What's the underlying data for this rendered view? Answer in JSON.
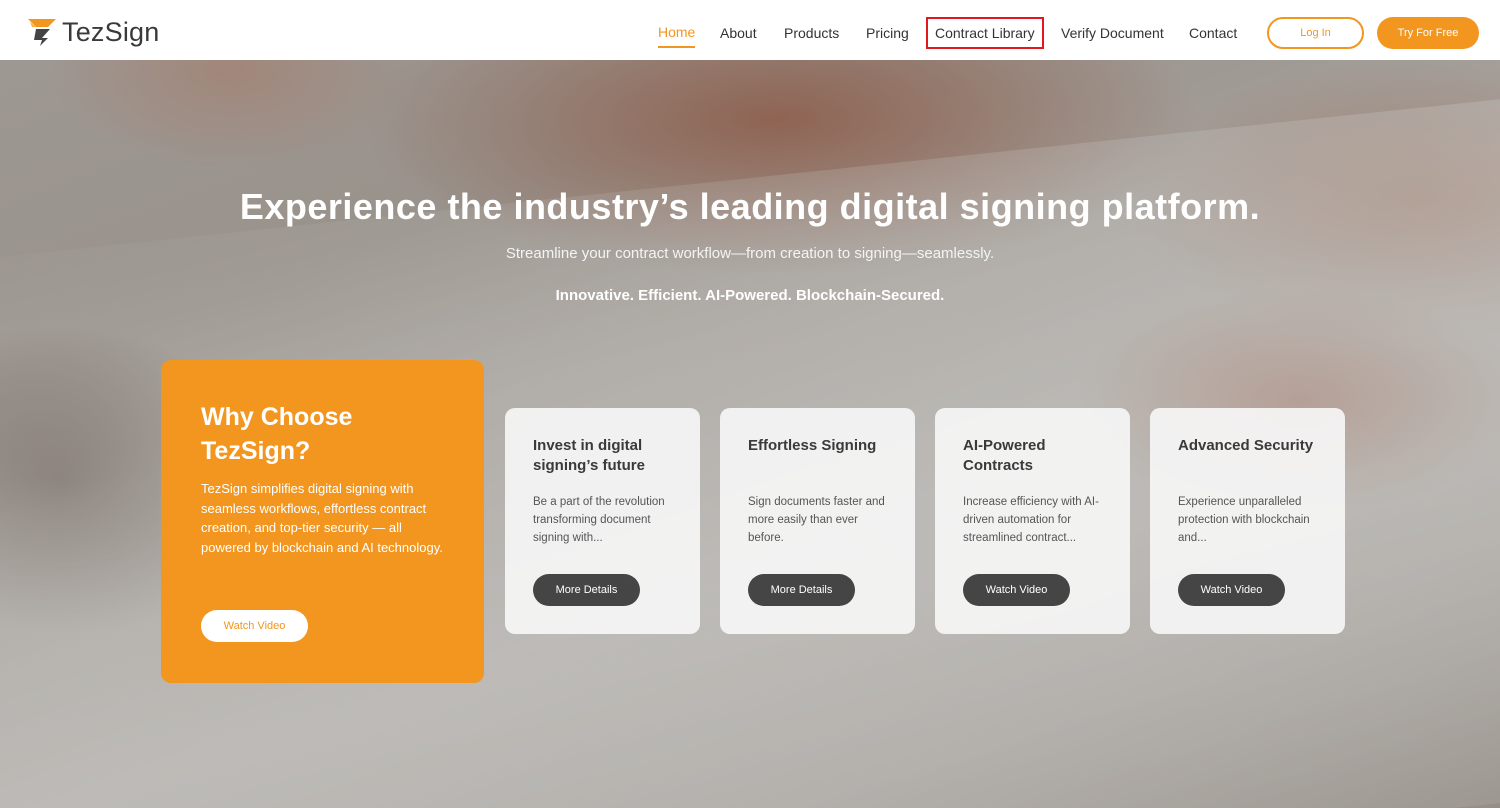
{
  "brand": {
    "name": "TezSign",
    "accent": "#f29620",
    "highlight_box": "#e0191f"
  },
  "nav": {
    "items": [
      "Home",
      "About",
      "Products",
      "Pricing",
      "Contract Library",
      "Verify Document",
      "Contact"
    ],
    "active": "Home",
    "login_label": "Log In",
    "try_label": "Try For Free"
  },
  "hero": {
    "title": "Experience the industry’s leading digital signing platform.",
    "subtitle": "Streamline your contract workflow—from creation to signing—seamlessly.",
    "tagline": "Innovative. Efficient. AI-Powered. Blockchain-Secured."
  },
  "why": {
    "title": "Why Choose TezSign?",
    "text": "TezSign simplifies digital signing with seamless workflows, effortless contract creation, and top-tier security — all powered by blockchain and AI technology.",
    "button": "Watch Video"
  },
  "cards": [
    {
      "title": "Invest in digital signing’s future",
      "text": "Be a part of the revolution transforming document signing with...",
      "button": "More Details"
    },
    {
      "title": "Effortless Signing",
      "text": "Sign documents faster and more easily than ever before.",
      "button": "More Details"
    },
    {
      "title": "AI-Powered Contracts",
      "text": "Increase efficiency with AI-driven automation for streamlined contract...",
      "button": "Watch Video"
    },
    {
      "title": "Advanced Security",
      "text": "Experience unparalleled protection with blockchain and...",
      "button": "Watch Video"
    }
  ]
}
